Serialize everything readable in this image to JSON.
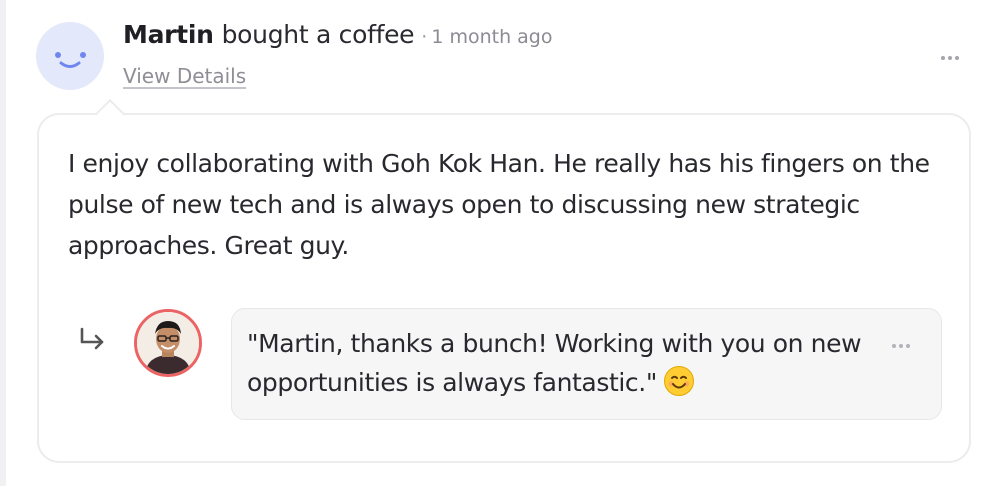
{
  "post": {
    "actor_name": "Martin",
    "action_text": "bought a coffee",
    "separator": "·",
    "timestamp": "1 month ago",
    "view_details_label": "View Details",
    "message": "I enjoy collaborating with Goh Kok Han. He really has his fingers on the pulse of new tech and is always open to discussing new strategic approaches. Great guy.",
    "avatar_icon": "smiley-avatar-icon",
    "more_icon": "more-horizontal-icon"
  },
  "reply": {
    "arrow_icon": "reply-arrow-icon",
    "text": "\"Martin, thanks a bunch! Working with you on new opportunities is always fantastic.\"",
    "emoji_icon": "smiling-face-emoji",
    "more_icon": "more-horizontal-icon"
  },
  "colors": {
    "avatar_bg": "#e3e8fb",
    "avatar_features": "#6f86ee",
    "reply_avatar_ring": "#ec6363",
    "card_border": "#ececef",
    "bubble_bg": "#f6f6f7"
  }
}
